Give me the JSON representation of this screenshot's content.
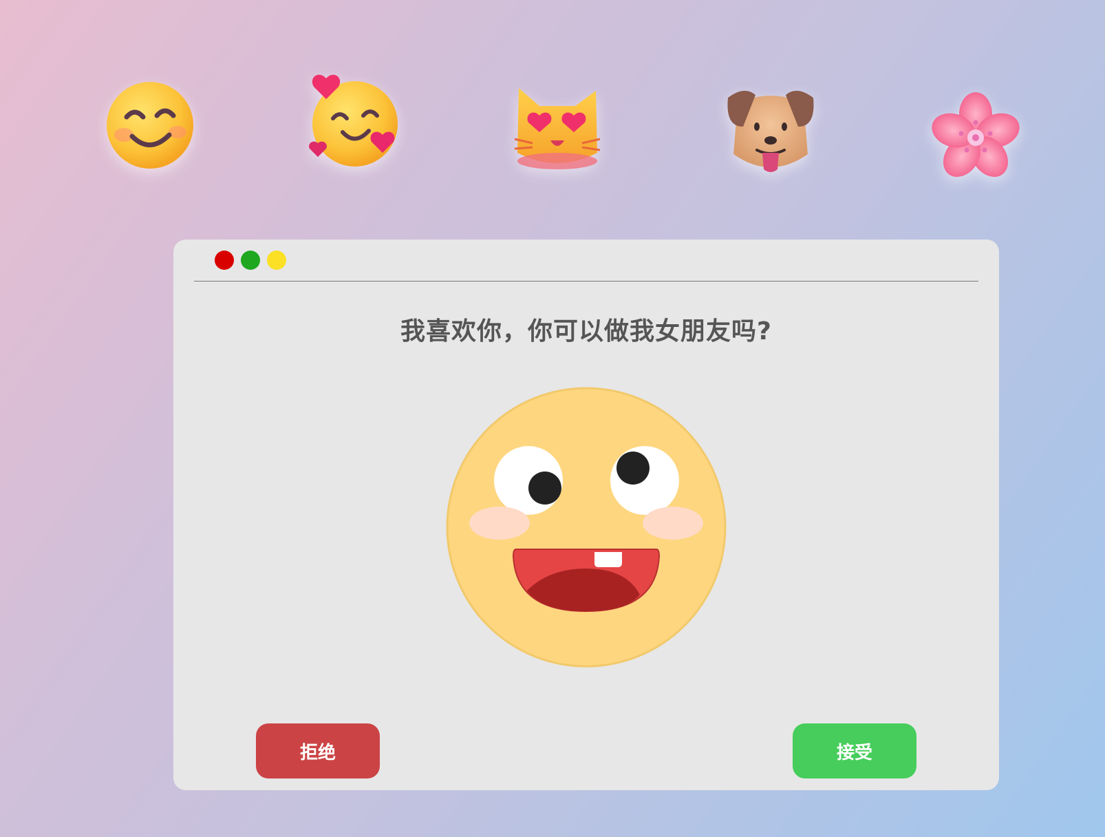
{
  "decorations": {
    "emojis": [
      {
        "name": "smiling-face-icon"
      },
      {
        "name": "smiling-face-with-hearts-icon"
      },
      {
        "name": "heart-eyes-cat-icon"
      },
      {
        "name": "dog-face-icon"
      },
      {
        "name": "cherry-blossom-icon"
      }
    ]
  },
  "window": {
    "controls": [
      "close",
      "maximize",
      "minimize"
    ],
    "control_colors": {
      "close": "#d90000",
      "maximize": "#1fa81f",
      "minimize": "#fbe025"
    },
    "question": "我喜欢你，你可以做我女朋友吗?",
    "face_icon": "excited-face-icon",
    "buttons": {
      "reject_label": "拒绝",
      "accept_label": "接受"
    }
  },
  "colors": {
    "window_bg": "#e7e7e7",
    "reject": "#cc4345",
    "accept": "#46cd5c",
    "face": "#fed67f",
    "text": "#555555"
  }
}
